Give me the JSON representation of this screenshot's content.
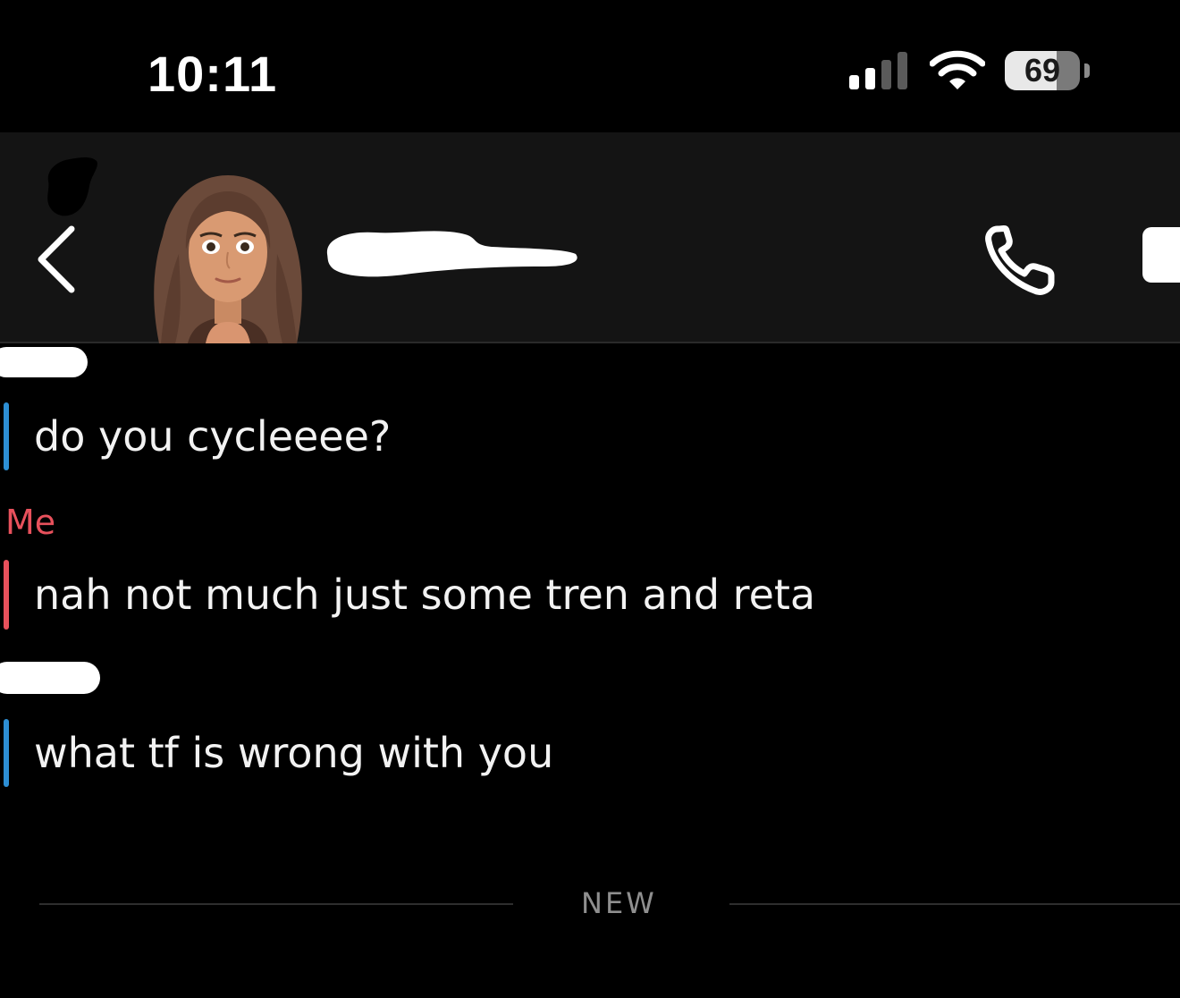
{
  "status_bar": {
    "time": "10:11",
    "battery_percent": 69,
    "battery_label": "69",
    "signal_bars_active": 2,
    "signal_bars_total": 4
  },
  "header": {
    "back_icon": "chevron-left-icon",
    "call_icon": "phone-icon",
    "video_icon": "video-camera-icon"
  },
  "messages": [
    {
      "text": "do you cycleeee?",
      "bar_color": "#2d8fd5"
    },
    {
      "sender": "Me",
      "sender_color": "#e8515c",
      "text": "nah not much just some tren and reta",
      "bar_color": "#e8515c"
    },
    {
      "text": "what tf is wrong with you",
      "bar_color": "#2d8fd5"
    }
  ],
  "divider": {
    "label": "NEW"
  },
  "colors": {
    "background": "#000000",
    "header_bg": "#141414",
    "incoming_accent": "#2d8fd5",
    "outgoing_accent": "#e8515c"
  }
}
